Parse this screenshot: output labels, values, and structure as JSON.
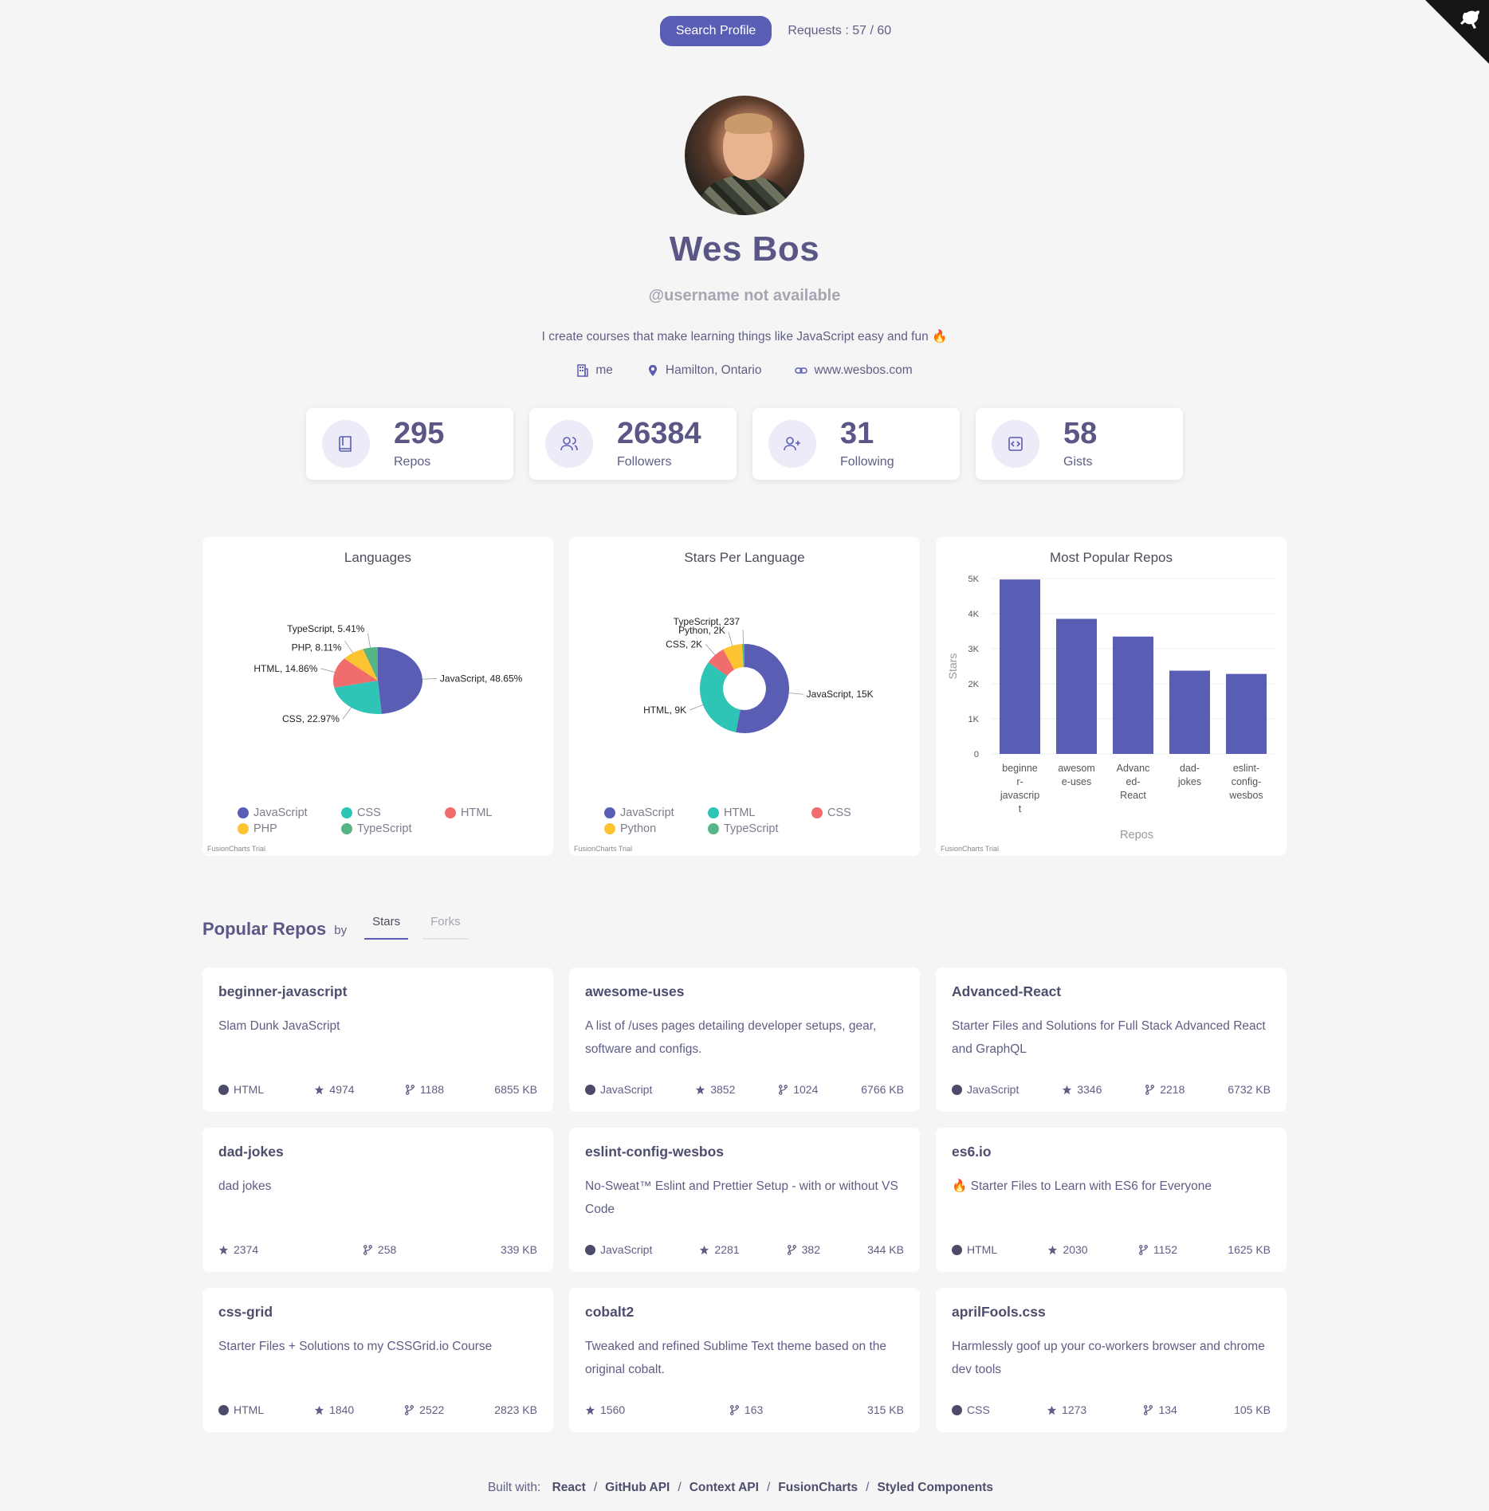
{
  "header": {
    "search_button": "Search Profile",
    "requests": "Requests : 57 / 60"
  },
  "profile": {
    "name": "Wes Bos",
    "username": "@username not available",
    "bio": "I create courses that make learning things like JavaScript easy and fun 🔥",
    "company": "me",
    "location": "Hamilton, Ontario",
    "website": "www.wesbos.com"
  },
  "stats": [
    {
      "value": "295",
      "label": "Repos",
      "icon": "book-icon"
    },
    {
      "value": "26384",
      "label": "Followers",
      "icon": "users-icon"
    },
    {
      "value": "31",
      "label": "Following",
      "icon": "user-plus-icon"
    },
    {
      "value": "58",
      "label": "Gists",
      "icon": "code-icon"
    }
  ],
  "charts": {
    "trial_label": "FusionCharts Trial"
  },
  "chart_data": [
    {
      "type": "pie",
      "title": "Languages",
      "categories": [
        "JavaScript",
        "CSS",
        "HTML",
        "PHP",
        "TypeScript"
      ],
      "values": [
        48.65,
        22.97,
        14.86,
        8.11,
        5.41
      ],
      "labels": [
        "JavaScript, 48.65%",
        "CSS, 22.97%",
        "HTML, 14.86%",
        "PHP, 8.11%",
        "TypeScript, 5.41%"
      ],
      "colors": [
        "#5a5db4",
        "#2ec4b6",
        "#f16d6d",
        "#fcc430",
        "#55b585"
      ],
      "legend": [
        "JavaScript",
        "CSS",
        "HTML",
        "PHP",
        "TypeScript"
      ]
    },
    {
      "type": "pie",
      "title": "Stars Per Language",
      "categories": [
        "JavaScript",
        "HTML",
        "CSS",
        "Python",
        "TypeScript"
      ],
      "values": [
        15000,
        9000,
        2000,
        2000,
        237
      ],
      "labels": [
        "JavaScript, 15K",
        "HTML, 9K",
        "CSS, 2K",
        "Python, 2K",
        "TypeScript, 237"
      ],
      "colors": [
        "#5a5db4",
        "#2ec4b6",
        "#f16d6d",
        "#fcc430",
        "#55b585"
      ],
      "legend": [
        "JavaScript",
        "HTML",
        "CSS",
        "Python",
        "TypeScript"
      ]
    },
    {
      "type": "bar",
      "title": "Most Popular Repos",
      "categories": [
        "beginner-javascript",
        "awesome-uses",
        "Advanced-React",
        "dad-jokes",
        "eslint-config-wesbos"
      ],
      "category_labels": [
        [
          "beginne",
          "r-",
          "javascrip",
          "t"
        ],
        [
          "awesom",
          "e-uses"
        ],
        [
          "Advanc",
          "ed-",
          "React"
        ],
        [
          "dad-",
          "jokes"
        ],
        [
          "eslint-",
          "config-",
          "wesbos"
        ]
      ],
      "values": [
        4974,
        3852,
        3346,
        2374,
        2281
      ],
      "xlabel": "Repos",
      "ylabel": "Stars",
      "ylim": [
        0,
        5000
      ],
      "yticks": [
        "0",
        "1K",
        "2K",
        "3K",
        "4K",
        "5K"
      ],
      "color": "#5a5db4",
      "grid": true
    }
  ],
  "popular": {
    "title": "Popular Repos",
    "by": "by",
    "tab_stars": "Stars",
    "tab_forks": "Forks"
  },
  "repos": [
    {
      "name": "beginner-javascript",
      "desc": "Slam Dunk JavaScript",
      "lang": "HTML",
      "stars": "4974",
      "forks": "1188",
      "size": "6855 KB"
    },
    {
      "name": "awesome-uses",
      "desc": "A list of /uses pages detailing developer setups, gear, software and configs.",
      "lang": "JavaScript",
      "stars": "3852",
      "forks": "1024",
      "size": "6766 KB"
    },
    {
      "name": "Advanced-React",
      "desc": "Starter Files and Solutions for Full Stack Advanced React and GraphQL",
      "lang": "JavaScript",
      "stars": "3346",
      "forks": "2218",
      "size": "6732 KB"
    },
    {
      "name": "dad-jokes",
      "desc": "dad jokes",
      "lang": "",
      "stars": "2374",
      "forks": "258",
      "size": "339 KB"
    },
    {
      "name": "eslint-config-wesbos",
      "desc": "No-Sweat™ Eslint and Prettier Setup - with or without VS Code",
      "lang": "JavaScript",
      "stars": "2281",
      "forks": "382",
      "size": "344 KB"
    },
    {
      "name": "es6.io",
      "desc": "🔥 Starter Files to Learn with ES6 for Everyone",
      "lang": "HTML",
      "stars": "2030",
      "forks": "1152",
      "size": "1625 KB"
    },
    {
      "name": "css-grid",
      "desc": "Starter Files + Solutions to my CSSGrid.io Course",
      "lang": "HTML",
      "stars": "1840",
      "forks": "2522",
      "size": "2823 KB"
    },
    {
      "name": "cobalt2",
      "desc": "Tweaked and refined Sublime Text theme based on the original cobalt.",
      "lang": "",
      "stars": "1560",
      "forks": "163",
      "size": "315 KB"
    },
    {
      "name": "aprilFools.css",
      "desc": "Harmlessly goof up your co-workers browser and chrome dev tools",
      "lang": "CSS",
      "stars": "1273",
      "forks": "134",
      "size": "105 KB"
    }
  ],
  "footer": {
    "prefix": "Built with:",
    "links": [
      "React",
      "GitHub API",
      "Context API",
      "FusionCharts",
      "Styled Components"
    ],
    "sep": "/"
  }
}
